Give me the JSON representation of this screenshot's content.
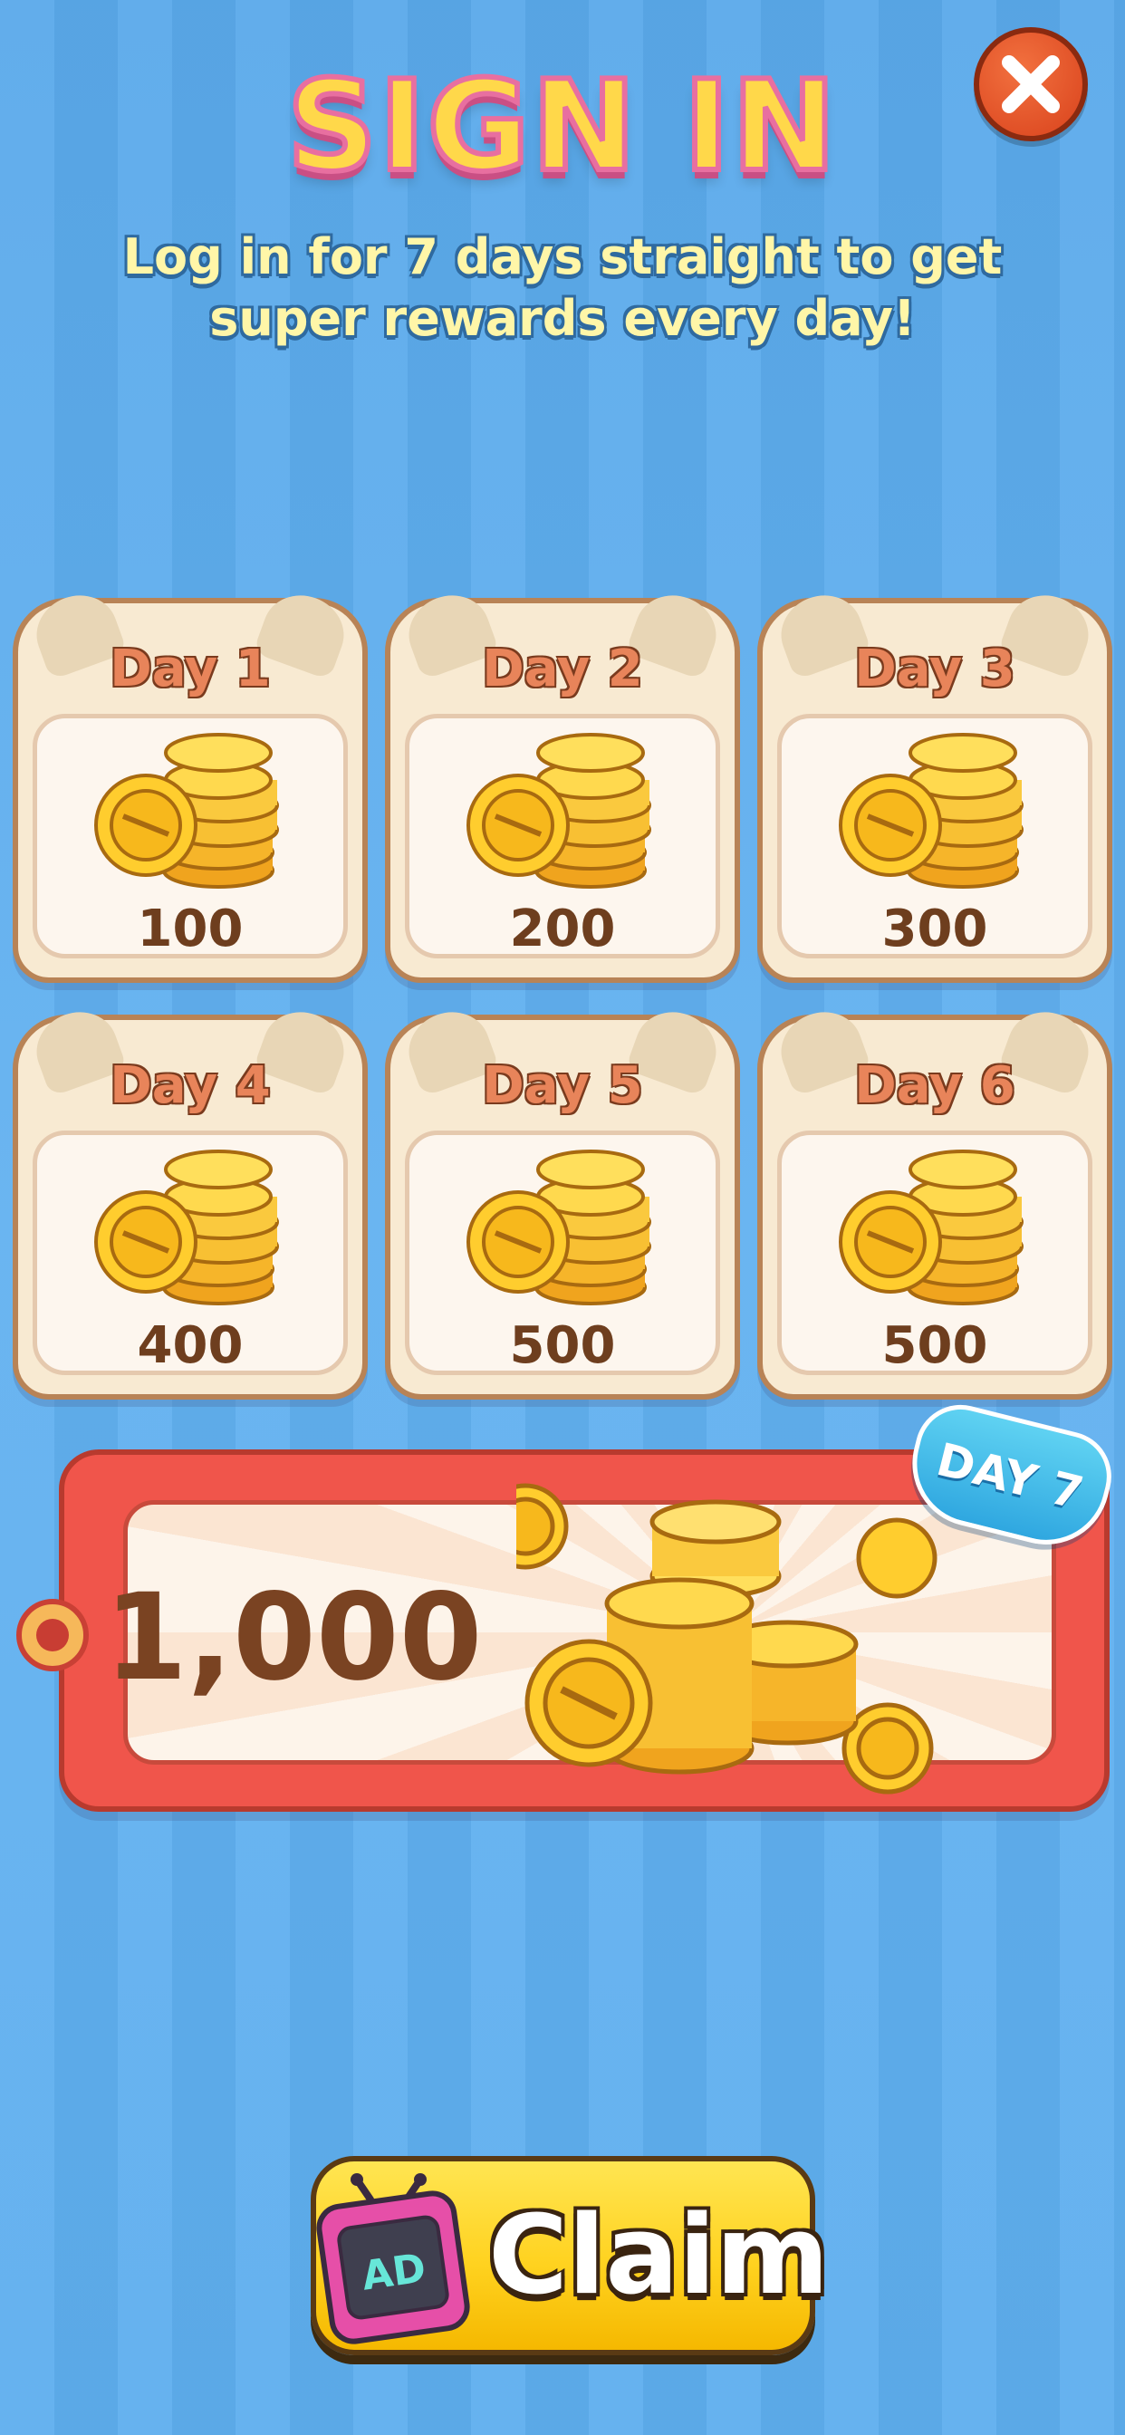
{
  "header": {
    "title": "SIGN IN",
    "subtitle": "Log in for 7 days straight to get super rewards every day!",
    "close_icon": "close-x-icon"
  },
  "rewards": [
    {
      "label": "Day 1",
      "amount": "100"
    },
    {
      "label": "Day 2",
      "amount": "200"
    },
    {
      "label": "Day 3",
      "amount": "300"
    },
    {
      "label": "Day 4",
      "amount": "400"
    },
    {
      "label": "Day 5",
      "amount": "500"
    },
    {
      "label": "Day 6",
      "amount": "500"
    }
  ],
  "day7": {
    "badge": "DAY 7",
    "amount": "1,000"
  },
  "claim": {
    "ad_label": "AD",
    "label": "Claim"
  },
  "colors": {
    "background": "#5eaeee",
    "title_fill": "#ffd84a",
    "title_stroke": "#e86fa0",
    "card_bg": "#f8ead2",
    "tag_red": "#f0554b",
    "claim_yellow": "#ffd21f"
  }
}
